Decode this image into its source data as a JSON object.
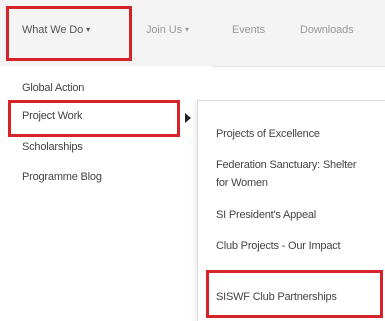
{
  "nav": {
    "items": [
      {
        "label": "What We Do",
        "caret": "▾"
      },
      {
        "label": "Join Us",
        "caret": "▾"
      },
      {
        "label": "Events"
      },
      {
        "label": "Downloads"
      }
    ]
  },
  "dropdown": {
    "items": [
      {
        "label": "Global Action"
      },
      {
        "label": "Project Work"
      },
      {
        "label": "Scholarships"
      },
      {
        "label": "Programme Blog"
      }
    ]
  },
  "submenu": {
    "items": [
      {
        "label": "Projects of Excellence"
      },
      {
        "label": "Federation Sanctuary: Shelter for Women"
      },
      {
        "label": "SI President's Appeal"
      },
      {
        "label": "Club Projects - Our Impact"
      },
      {
        "label": "SISWF Club Partnerships"
      }
    ]
  },
  "colors": {
    "highlight": "#d6232a",
    "navbar_bg": "#f4f4f4"
  }
}
